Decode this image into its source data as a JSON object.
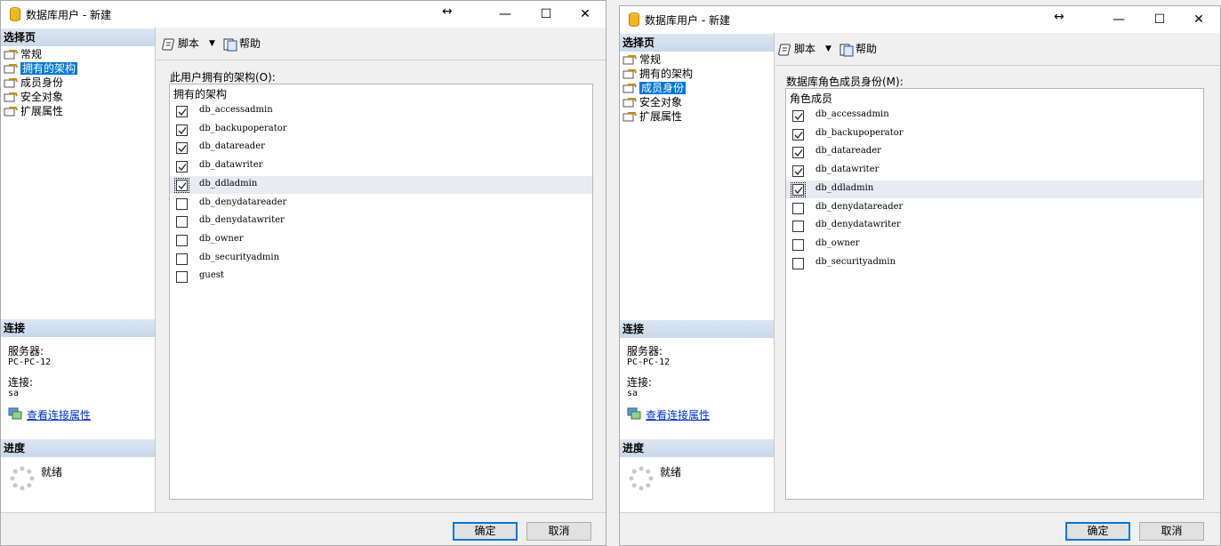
{
  "windows": [
    {
      "id": "left",
      "title": "数据库用户 - 新建",
      "resize_glyph": "↔",
      "controls": {
        "minimize": "—",
        "maximize": "☐",
        "close": "✕"
      },
      "sidebar": {
        "select_page_header": "选择页",
        "nav_items": [
          {
            "label": "常规",
            "selected": false
          },
          {
            "label": "拥有的架构",
            "selected": true
          },
          {
            "label": "成员身份",
            "selected": false
          },
          {
            "label": "安全对象",
            "selected": false
          },
          {
            "label": "扩展属性",
            "selected": false
          }
        ],
        "connection_header": "连接",
        "server_label": "服务器:",
        "server_value": "PC-PC-12",
        "connection_label": "连接:",
        "connection_value": "sa",
        "view_link": "查看连接属性",
        "progress_header": "进度",
        "progress_status": "就绪"
      },
      "toolbar": {
        "script": "脚本",
        "help": "帮助"
      },
      "section_label": "此用户拥有的架构(O):",
      "list_header": "拥有的架构",
      "items": [
        {
          "label": "db_accessadmin",
          "checked": true
        },
        {
          "label": "db_backupoperator",
          "checked": true
        },
        {
          "label": "db_datareader",
          "checked": true
        },
        {
          "label": "db_datawriter",
          "checked": true
        },
        {
          "label": "db_ddladmin",
          "checked": true
        },
        {
          "label": "db_denydatareader",
          "checked": false
        },
        {
          "label": "db_denydatawriter",
          "checked": false
        },
        {
          "label": "db_owner",
          "checked": false
        },
        {
          "label": "db_securityadmin",
          "checked": false
        },
        {
          "label": "guest",
          "checked": false
        }
      ],
      "ok": "确定",
      "cancel": "取消"
    },
    {
      "id": "right",
      "title": "数据库用户 - 新建",
      "resize_glyph": "↔",
      "controls": {
        "minimize": "—",
        "maximize": "☐",
        "close": "✕"
      },
      "sidebar": {
        "select_page_header": "选择页",
        "nav_items": [
          {
            "label": "常规",
            "selected": false
          },
          {
            "label": "拥有的架构",
            "selected": false
          },
          {
            "label": "成员身份",
            "selected": true
          },
          {
            "label": "安全对象",
            "selected": false
          },
          {
            "label": "扩展属性",
            "selected": false
          }
        ],
        "connection_header": "连接",
        "server_label": "服务器:",
        "server_value": "PC-PC-12",
        "connection_label": "连接:",
        "connection_value": "sa",
        "view_link": "查看连接属性",
        "progress_header": "进度",
        "progress_status": "就绪"
      },
      "toolbar": {
        "script": "脚本",
        "help": "帮助"
      },
      "section_label": "数据库角色成员身份(M):",
      "list_header": "角色成员",
      "items": [
        {
          "label": "db_accessadmin",
          "checked": true
        },
        {
          "label": "db_backupoperator",
          "checked": true
        },
        {
          "label": "db_datareader",
          "checked": true
        },
        {
          "label": "db_datawriter",
          "checked": true
        },
        {
          "label": "db_ddladmin",
          "checked": true
        },
        {
          "label": "db_denydatareader",
          "checked": false
        },
        {
          "label": "db_denydatawriter",
          "checked": false
        },
        {
          "label": "db_owner",
          "checked": false
        },
        {
          "label": "db_securityadmin",
          "checked": false
        }
      ],
      "ok": "确定",
      "cancel": "取消"
    }
  ]
}
